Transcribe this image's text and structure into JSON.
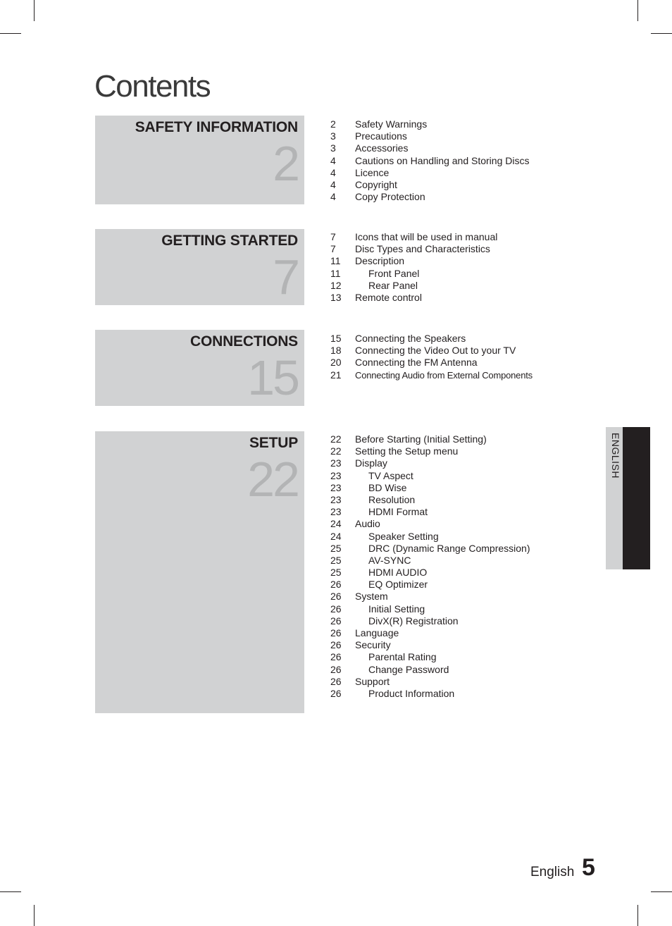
{
  "page": {
    "title": "Contents",
    "footer_language": "English",
    "footer_page_number": "5",
    "language_tab": "ENGLISH"
  },
  "sections": [
    {
      "title": "SAFETY INFORMATION",
      "start_page": "2",
      "entries": [
        {
          "page": "2",
          "label": "Safety Warnings",
          "level": 1
        },
        {
          "page": "3",
          "label": "Precautions",
          "level": 1
        },
        {
          "page": "3",
          "label": "Accessories",
          "level": 1
        },
        {
          "page": "4",
          "label": "Cautions on Handling and Storing Discs",
          "level": 1
        },
        {
          "page": "4",
          "label": "Licence",
          "level": 1
        },
        {
          "page": "4",
          "label": "Copyright",
          "level": 1
        },
        {
          "page": "4",
          "label": "Copy Protection",
          "level": 1
        }
      ]
    },
    {
      "title": "GETTING STARTED",
      "start_page": "7",
      "entries": [
        {
          "page": "7",
          "label": "Icons that will be used in manual",
          "level": 1
        },
        {
          "page": "7",
          "label": "Disc Types and Characteristics",
          "level": 1
        },
        {
          "page": "11",
          "label": "Description",
          "level": 1
        },
        {
          "page": "11",
          "label": "Front Panel",
          "level": 2
        },
        {
          "page": "12",
          "label": "Rear Panel",
          "level": 2
        },
        {
          "page": "13",
          "label": "Remote control",
          "level": 1
        }
      ]
    },
    {
      "title": "CONNECTIONS",
      "start_page": "15",
      "entries": [
        {
          "page": "15",
          "label": "Connecting the Speakers",
          "level": 1
        },
        {
          "page": "18",
          "label": "Connecting the Video Out to your TV",
          "level": 1
        },
        {
          "page": "20",
          "label": "Connecting the FM Antenna",
          "level": 1
        },
        {
          "page": "21",
          "label": "Connecting Audio from External Components",
          "level": 1
        }
      ]
    },
    {
      "title": "SETUP",
      "start_page": "22",
      "entries": [
        {
          "page": "22",
          "label": "Before Starting (Initial Setting)",
          "level": 1
        },
        {
          "page": "22",
          "label": "Setting the Setup menu",
          "level": 1
        },
        {
          "page": "23",
          "label": "Display",
          "level": 1
        },
        {
          "page": "23",
          "label": "TV Aspect",
          "level": 2
        },
        {
          "page": "23",
          "label": "BD Wise",
          "level": 2
        },
        {
          "page": "23",
          "label": "Resolution",
          "level": 2
        },
        {
          "page": "23",
          "label": "HDMI Format",
          "level": 2
        },
        {
          "page": "24",
          "label": "Audio",
          "level": 1
        },
        {
          "page": "24",
          "label": "Speaker Setting",
          "level": 2
        },
        {
          "page": "25",
          "label": "DRC (Dynamic Range Compression)",
          "level": 2
        },
        {
          "page": "25",
          "label": "AV-SYNC",
          "level": 2
        },
        {
          "page": "25",
          "label": "HDMI AUDIO",
          "level": 2
        },
        {
          "page": "26",
          "label": "EQ Optimizer",
          "level": 2
        },
        {
          "page": "26",
          "label": "System",
          "level": 1
        },
        {
          "page": "26",
          "label": "Initial Setting",
          "level": 2
        },
        {
          "page": "26",
          "label": "DivX(R) Registration",
          "level": 2
        },
        {
          "page": "26",
          "label": "Language",
          "level": 1
        },
        {
          "page": "26",
          "label": "Security",
          "level": 1
        },
        {
          "page": "26",
          "label": "Parental Rating",
          "level": 2
        },
        {
          "page": "26",
          "label": "Change Password",
          "level": 2
        },
        {
          "page": "26",
          "label": "Support",
          "level": 1
        },
        {
          "page": "26",
          "label": "Product Information",
          "level": 2
        }
      ]
    }
  ]
}
